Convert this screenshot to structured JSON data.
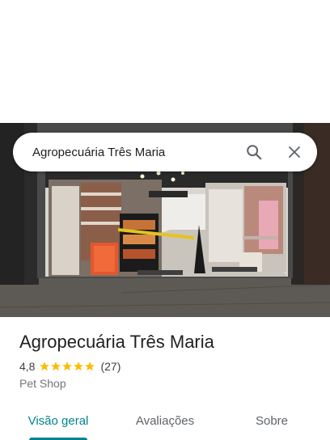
{
  "search": {
    "query": "Agropecuária Três Maria",
    "search_icon": "search-icon",
    "close_icon": "close-icon"
  },
  "place": {
    "title": "Agropecuária Três Maria",
    "rating": "4,8",
    "rating_stars": 5,
    "review_count": "(27)",
    "category": "Pet Shop"
  },
  "tabs": [
    {
      "label": "Visão geral",
      "active": true
    },
    {
      "label": "Avaliações",
      "active": false
    },
    {
      "label": "Sobre",
      "active": false
    }
  ],
  "colors": {
    "accent": "#00838f",
    "star": "#fbbc04",
    "text_primary": "#202124",
    "text_secondary": "#70757a"
  }
}
